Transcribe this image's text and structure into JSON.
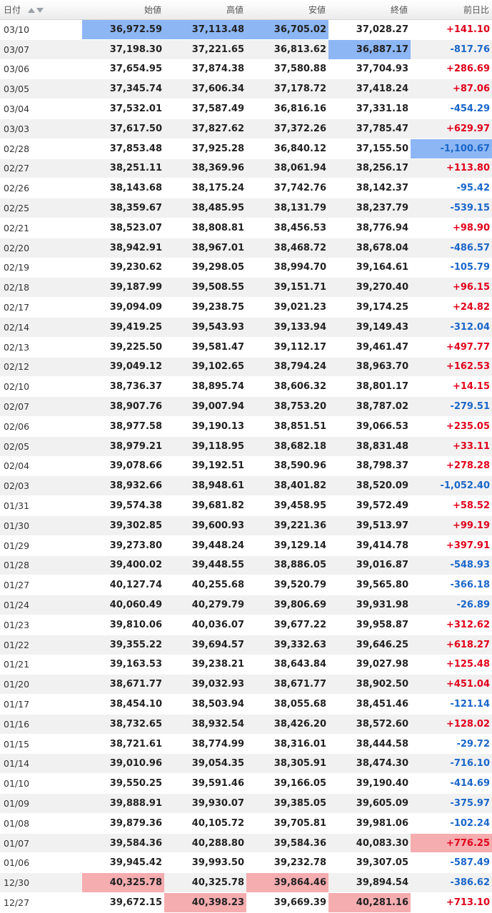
{
  "table": {
    "headers": [
      "日付",
      "始値",
      "高値",
      "安値",
      "終値",
      "前日比"
    ],
    "rows": [
      {
        "date": "03/10",
        "open": "36,972.59",
        "high": "37,113.48",
        "low": "36,705.02",
        "close": "37,028.27",
        "change": "+141.10",
        "hl": [
          "open:blue",
          "high:blue",
          "low:blue"
        ]
      },
      {
        "date": "03/07",
        "open": "37,198.30",
        "high": "37,221.65",
        "low": "36,813.62",
        "close": "36,887.17",
        "change": "-817.76",
        "hl": [
          "close:blue"
        ]
      },
      {
        "date": "03/06",
        "open": "37,654.95",
        "high": "37,874.38",
        "low": "37,580.88",
        "close": "37,704.93",
        "change": "+286.69",
        "hl": []
      },
      {
        "date": "03/05",
        "open": "37,345.74",
        "high": "37,606.34",
        "low": "37,178.72",
        "close": "37,418.24",
        "change": "+87.06",
        "hl": []
      },
      {
        "date": "03/04",
        "open": "37,532.01",
        "high": "37,587.49",
        "low": "36,816.16",
        "close": "37,331.18",
        "change": "-454.29",
        "hl": []
      },
      {
        "date": "03/03",
        "open": "37,617.50",
        "high": "37,827.62",
        "low": "37,372.26",
        "close": "37,785.47",
        "change": "+629.97",
        "hl": []
      },
      {
        "date": "02/28",
        "open": "37,853.48",
        "high": "37,925.28",
        "low": "36,840.12",
        "close": "37,155.50",
        "change": "-1,100.67",
        "hl": [
          "change:blue"
        ]
      },
      {
        "date": "02/27",
        "open": "38,251.11",
        "high": "38,369.96",
        "low": "38,061.94",
        "close": "38,256.17",
        "change": "+113.80",
        "hl": []
      },
      {
        "date": "02/26",
        "open": "38,143.68",
        "high": "38,175.24",
        "low": "37,742.76",
        "close": "38,142.37",
        "change": "-95.42",
        "hl": []
      },
      {
        "date": "02/25",
        "open": "38,359.67",
        "high": "38,485.95",
        "low": "38,131.79",
        "close": "38,237.79",
        "change": "-539.15",
        "hl": []
      },
      {
        "date": "02/21",
        "open": "38,523.07",
        "high": "38,808.81",
        "low": "38,456.53",
        "close": "38,776.94",
        "change": "+98.90",
        "hl": []
      },
      {
        "date": "02/20",
        "open": "38,942.91",
        "high": "38,967.01",
        "low": "38,468.72",
        "close": "38,678.04",
        "change": "-486.57",
        "hl": []
      },
      {
        "date": "02/19",
        "open": "39,230.62",
        "high": "39,298.05",
        "low": "38,994.70",
        "close": "39,164.61",
        "change": "-105.79",
        "hl": []
      },
      {
        "date": "02/18",
        "open": "39,187.99",
        "high": "39,508.55",
        "low": "39,151.71",
        "close": "39,270.40",
        "change": "+96.15",
        "hl": []
      },
      {
        "date": "02/17",
        "open": "39,094.09",
        "high": "39,238.75",
        "low": "39,021.23",
        "close": "39,174.25",
        "change": "+24.82",
        "hl": []
      },
      {
        "date": "02/14",
        "open": "39,419.25",
        "high": "39,543.93",
        "low": "39,133.94",
        "close": "39,149.43",
        "change": "-312.04",
        "hl": []
      },
      {
        "date": "02/13",
        "open": "39,225.50",
        "high": "39,581.47",
        "low": "39,112.17",
        "close": "39,461.47",
        "change": "+497.77",
        "hl": []
      },
      {
        "date": "02/12",
        "open": "39,049.12",
        "high": "39,102.65",
        "low": "38,794.24",
        "close": "38,963.70",
        "change": "+162.53",
        "hl": []
      },
      {
        "date": "02/10",
        "open": "38,736.37",
        "high": "38,895.74",
        "low": "38,606.32",
        "close": "38,801.17",
        "change": "+14.15",
        "hl": []
      },
      {
        "date": "02/07",
        "open": "38,907.76",
        "high": "39,007.94",
        "low": "38,753.20",
        "close": "38,787.02",
        "change": "-279.51",
        "hl": []
      },
      {
        "date": "02/06",
        "open": "38,977.58",
        "high": "39,190.13",
        "low": "38,851.51",
        "close": "39,066.53",
        "change": "+235.05",
        "hl": []
      },
      {
        "date": "02/05",
        "open": "38,979.21",
        "high": "39,118.95",
        "low": "38,682.18",
        "close": "38,831.48",
        "change": "+33.11",
        "hl": []
      },
      {
        "date": "02/04",
        "open": "39,078.66",
        "high": "39,192.51",
        "low": "38,590.96",
        "close": "38,798.37",
        "change": "+278.28",
        "hl": []
      },
      {
        "date": "02/03",
        "open": "38,932.66",
        "high": "38,948.61",
        "low": "38,401.82",
        "close": "38,520.09",
        "change": "-1,052.40",
        "hl": []
      },
      {
        "date": "01/31",
        "open": "39,574.38",
        "high": "39,681.82",
        "low": "39,458.95",
        "close": "39,572.49",
        "change": "+58.52",
        "hl": []
      },
      {
        "date": "01/30",
        "open": "39,302.85",
        "high": "39,600.93",
        "low": "39,221.36",
        "close": "39,513.97",
        "change": "+99.19",
        "hl": []
      },
      {
        "date": "01/29",
        "open": "39,273.80",
        "high": "39,448.24",
        "low": "39,129.14",
        "close": "39,414.78",
        "change": "+397.91",
        "hl": []
      },
      {
        "date": "01/28",
        "open": "39,400.02",
        "high": "39,448.55",
        "low": "38,886.05",
        "close": "39,016.87",
        "change": "-548.93",
        "hl": []
      },
      {
        "date": "01/27",
        "open": "40,127.74",
        "high": "40,255.68",
        "low": "39,520.79",
        "close": "39,565.80",
        "change": "-366.18",
        "hl": []
      },
      {
        "date": "01/24",
        "open": "40,060.49",
        "high": "40,279.79",
        "low": "39,806.69",
        "close": "39,931.98",
        "change": "-26.89",
        "hl": []
      },
      {
        "date": "01/23",
        "open": "39,810.06",
        "high": "40,036.07",
        "low": "39,677.22",
        "close": "39,958.87",
        "change": "+312.62",
        "hl": []
      },
      {
        "date": "01/22",
        "open": "39,355.22",
        "high": "39,694.57",
        "low": "39,332.63",
        "close": "39,646.25",
        "change": "+618.27",
        "hl": []
      },
      {
        "date": "01/21",
        "open": "39,163.53",
        "high": "39,238.21",
        "low": "38,643.84",
        "close": "39,027.98",
        "change": "+125.48",
        "hl": []
      },
      {
        "date": "01/20",
        "open": "38,671.77",
        "high": "39,032.93",
        "low": "38,671.77",
        "close": "38,902.50",
        "change": "+451.04",
        "hl": []
      },
      {
        "date": "01/17",
        "open": "38,454.10",
        "high": "38,503.94",
        "low": "38,055.68",
        "close": "38,451.46",
        "change": "-121.14",
        "hl": []
      },
      {
        "date": "01/16",
        "open": "38,732.65",
        "high": "38,932.54",
        "low": "38,426.20",
        "close": "38,572.60",
        "change": "+128.02",
        "hl": []
      },
      {
        "date": "01/15",
        "open": "38,721.61",
        "high": "38,774.99",
        "low": "38,316.01",
        "close": "38,444.58",
        "change": "-29.72",
        "hl": []
      },
      {
        "date": "01/14",
        "open": "39,010.96",
        "high": "39,054.35",
        "low": "38,305.91",
        "close": "38,474.30",
        "change": "-716.10",
        "hl": []
      },
      {
        "date": "01/10",
        "open": "39,550.25",
        "high": "39,591.46",
        "low": "39,166.05",
        "close": "39,190.40",
        "change": "-414.69",
        "hl": []
      },
      {
        "date": "01/09",
        "open": "39,888.91",
        "high": "39,930.07",
        "low": "39,385.05",
        "close": "39,605.09",
        "change": "-375.97",
        "hl": []
      },
      {
        "date": "01/08",
        "open": "39,879.36",
        "high": "40,105.72",
        "low": "39,705.81",
        "close": "39,981.06",
        "change": "-102.24",
        "hl": []
      },
      {
        "date": "01/07",
        "open": "39,584.36",
        "high": "40,288.80",
        "low": "39,584.36",
        "close": "40,083.30",
        "change": "+776.25",
        "hl": [
          "change:red"
        ]
      },
      {
        "date": "01/06",
        "open": "39,945.42",
        "high": "39,993.50",
        "low": "39,232.78",
        "close": "39,307.05",
        "change": "-587.49",
        "hl": []
      },
      {
        "date": "12/30",
        "open": "40,325.78",
        "high": "40,325.78",
        "low": "39,864.46",
        "close": "39,894.54",
        "change": "-386.62",
        "hl": [
          "open:red",
          "low:red"
        ]
      },
      {
        "date": "12/27",
        "open": "39,672.15",
        "high": "40,398.23",
        "low": "39,669.39",
        "close": "40,281.16",
        "change": "+713.10",
        "hl": [
          "high:red",
          "close:red"
        ]
      }
    ]
  },
  "colors": {
    "positive": "#e0001a",
    "negative": "#1a66c9",
    "highlight_blue": "#8db6f4",
    "highlight_red": "#f5adb0"
  },
  "icons": {
    "sort": "sort-asc-desc-icon"
  }
}
